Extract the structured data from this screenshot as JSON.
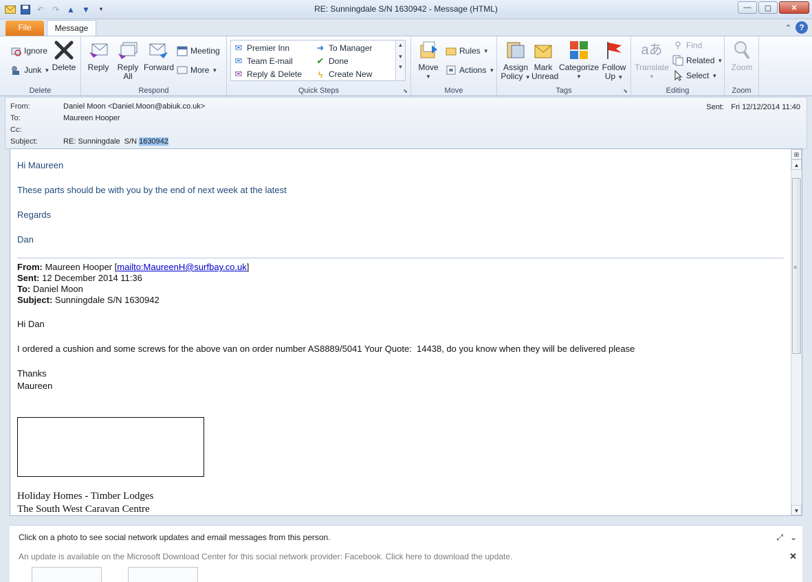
{
  "window": {
    "title": "RE: Sunningdale  S/N  1630942  -  Message (HTML)"
  },
  "tabs": {
    "file": "File",
    "message": "Message"
  },
  "ribbon": {
    "delete_group": {
      "label": "Delete",
      "ignore": "Ignore",
      "junk": "Junk",
      "delete": "Delete"
    },
    "respond_group": {
      "label": "Respond",
      "reply": "Reply",
      "reply_all_1": "Reply",
      "reply_all_2": "All",
      "forward": "Forward",
      "meeting": "Meeting",
      "more": "More"
    },
    "quicksteps_group": {
      "label": "Quick Steps",
      "items": [
        "Premier Inn",
        "Team E-mail",
        "Reply & Delete",
        "To Manager",
        "Done",
        "Create New"
      ]
    },
    "move_group": {
      "label": "Move",
      "move": "Move",
      "rules": "Rules",
      "actions": "Actions"
    },
    "tags_group": {
      "label": "Tags",
      "assign_1": "Assign",
      "assign_2": "Policy",
      "mark_1": "Mark",
      "mark_2": "Unread",
      "categorize": "Categorize",
      "follow_1": "Follow",
      "follow_2": "Up"
    },
    "editing_group": {
      "label": "Editing",
      "translate": "Translate",
      "find": "Find",
      "related": "Related",
      "select": "Select"
    },
    "zoom_group": {
      "label": "Zoom",
      "zoom": "Zoom"
    }
  },
  "header": {
    "from_label": "From:",
    "from_value": "Daniel Moon <Daniel.Moon@abiuk.co.uk>",
    "to_label": "To:",
    "to_value": "Maureen Hooper",
    "cc_label": "Cc:",
    "subject_label": "Subject:",
    "subject_value": "RE: Sunningdale  S/N ",
    "subject_selected": "1630942",
    "sent_label": "Sent:",
    "sent_value": "Fri 12/12/2014 11:40"
  },
  "body": {
    "greeting": "Hi Maureen",
    "line1": "These parts should be with you by the end of next week at the latest",
    "regards": "Regards",
    "signoff": "Dan",
    "quoted": {
      "from_label": "From:",
      "from_value": " Maureen Hooper [",
      "mailto": "mailto:MaureenH@surfbay.co.uk",
      "from_close": "]",
      "sent_label": "Sent:",
      "sent_value": " 12 December 2014 11:36",
      "to_label": "To:",
      "to_value": " Daniel Moon",
      "subject_label": "Subject:",
      "subject_value": " Sunningdale S/N 1630942",
      "greeting": "Hi Dan",
      "text": "I ordered a cushion and some screws for the above van on order number AS8889/5041 Your Quote:  14438, do you know when they will be delivered please",
      "thanks": "Thanks",
      "name": "Maureen",
      "company_1": "Holiday Homes - Timber Lodges",
      "company_2": "The South West Caravan Centre"
    }
  },
  "people_pane": {
    "info": "Click on a photo to see social network updates and email messages from this person.",
    "update": "An update is available on the Microsoft Download Center for this social network provider: Facebook. Click here to download the update."
  }
}
